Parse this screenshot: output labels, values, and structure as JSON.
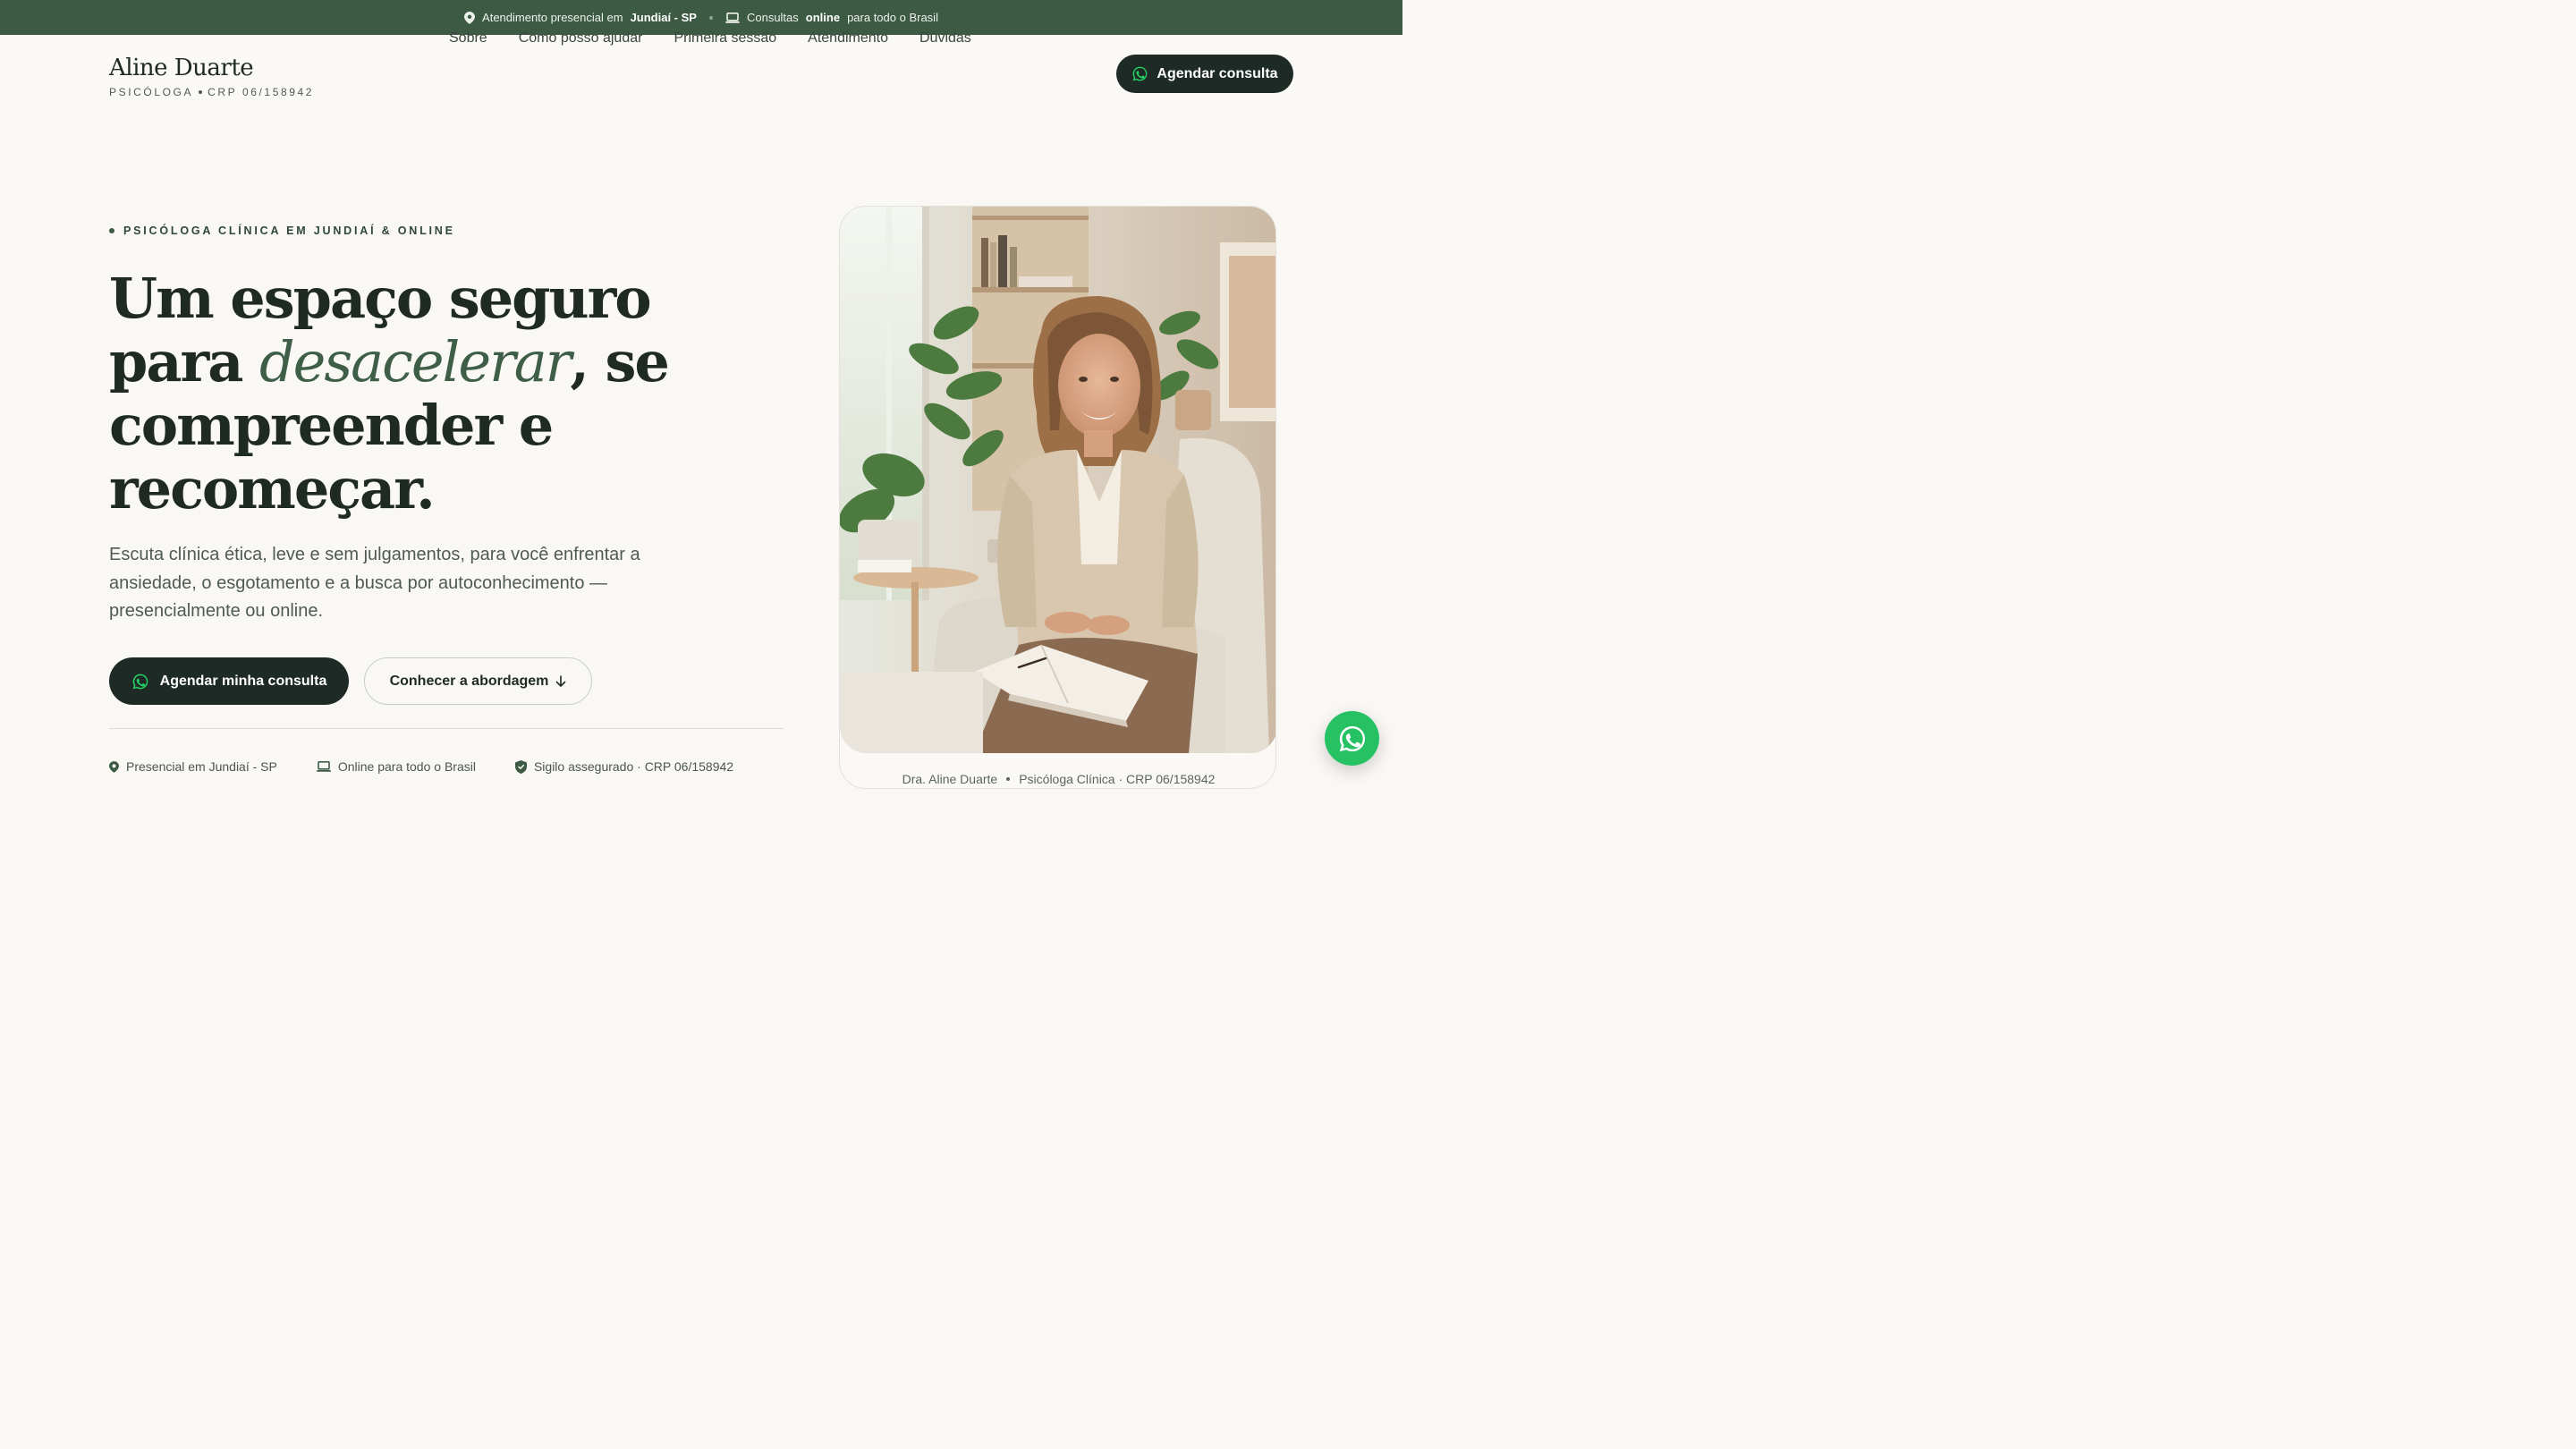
{
  "topbar": {
    "left_prefix": "Atendimento presencial em",
    "left_bold": "Jundiaí - SP",
    "right_prefix": "Consultas",
    "right_bold": "online",
    "right_suffix": "para todo o Brasil"
  },
  "brand": {
    "name": "Aline Duarte",
    "title": "PSICÓLOGA",
    "crp": "CRP 06/158942"
  },
  "nav": {
    "items": [
      "Sobre",
      "Como posso ajudar",
      "Primeira sessão",
      "Atendimento",
      "Dúvidas"
    ]
  },
  "header_cta": "Agendar consulta",
  "hero": {
    "eyebrow": "PSICÓLOGA CLÍNICA EM JUNDIAÍ & ONLINE",
    "headline_1": "Um espaço seguro para",
    "headline_em": "desacelerar",
    "headline_2": ", se compreender e recomeçar.",
    "lead": "Escuta clínica ética, leve e sem julgamentos, para você enfrentar a ansiedade, o esgotamento e a busca por autoconhecimento — presencialmente ou online.",
    "primary_cta": "Agendar minha consulta",
    "secondary_cta": "Conhecer a abordagem",
    "features": [
      "Presencial em Jundiaí - SP",
      "Online para todo o Brasil",
      "Sigilo assegurado · CRP 06/158942"
    ]
  },
  "photo_caption": {
    "name": "Dra. Aline Duarte",
    "role": "Psicóloga Clínica · CRP 06/158942"
  },
  "colors": {
    "topbar": "#3d5a45",
    "dark": "#1e2a25",
    "accent": "#3f5e48",
    "whatsapp": "#25c163"
  },
  "icons": [
    "pin-icon",
    "laptop-icon",
    "whatsapp-icon",
    "arrow-down-icon",
    "shield-icon"
  ]
}
